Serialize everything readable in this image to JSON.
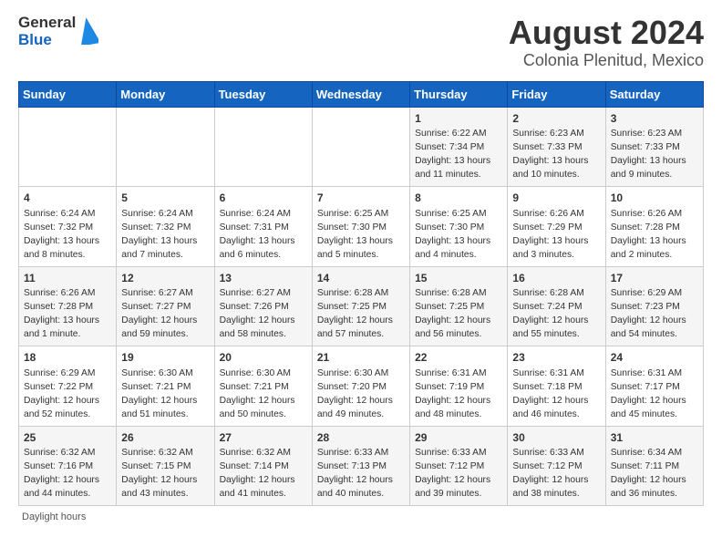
{
  "header": {
    "logo_line1": "General",
    "logo_line2": "Blue",
    "title": "August 2024",
    "subtitle": "Colonia Plenitud, Mexico"
  },
  "days_of_week": [
    "Sunday",
    "Monday",
    "Tuesday",
    "Wednesday",
    "Thursday",
    "Friday",
    "Saturday"
  ],
  "weeks": [
    [
      {
        "day": "",
        "info": ""
      },
      {
        "day": "",
        "info": ""
      },
      {
        "day": "",
        "info": ""
      },
      {
        "day": "",
        "info": ""
      },
      {
        "day": "1",
        "info": "Sunrise: 6:22 AM\nSunset: 7:34 PM\nDaylight: 13 hours and 11 minutes."
      },
      {
        "day": "2",
        "info": "Sunrise: 6:23 AM\nSunset: 7:33 PM\nDaylight: 13 hours and 10 minutes."
      },
      {
        "day": "3",
        "info": "Sunrise: 6:23 AM\nSunset: 7:33 PM\nDaylight: 13 hours and 9 minutes."
      }
    ],
    [
      {
        "day": "4",
        "info": "Sunrise: 6:24 AM\nSunset: 7:32 PM\nDaylight: 13 hours and 8 minutes."
      },
      {
        "day": "5",
        "info": "Sunrise: 6:24 AM\nSunset: 7:32 PM\nDaylight: 13 hours and 7 minutes."
      },
      {
        "day": "6",
        "info": "Sunrise: 6:24 AM\nSunset: 7:31 PM\nDaylight: 13 hours and 6 minutes."
      },
      {
        "day": "7",
        "info": "Sunrise: 6:25 AM\nSunset: 7:30 PM\nDaylight: 13 hours and 5 minutes."
      },
      {
        "day": "8",
        "info": "Sunrise: 6:25 AM\nSunset: 7:30 PM\nDaylight: 13 hours and 4 minutes."
      },
      {
        "day": "9",
        "info": "Sunrise: 6:26 AM\nSunset: 7:29 PM\nDaylight: 13 hours and 3 minutes."
      },
      {
        "day": "10",
        "info": "Sunrise: 6:26 AM\nSunset: 7:28 PM\nDaylight: 13 hours and 2 minutes."
      }
    ],
    [
      {
        "day": "11",
        "info": "Sunrise: 6:26 AM\nSunset: 7:28 PM\nDaylight: 13 hours and 1 minute."
      },
      {
        "day": "12",
        "info": "Sunrise: 6:27 AM\nSunset: 7:27 PM\nDaylight: 12 hours and 59 minutes."
      },
      {
        "day": "13",
        "info": "Sunrise: 6:27 AM\nSunset: 7:26 PM\nDaylight: 12 hours and 58 minutes."
      },
      {
        "day": "14",
        "info": "Sunrise: 6:28 AM\nSunset: 7:25 PM\nDaylight: 12 hours and 57 minutes."
      },
      {
        "day": "15",
        "info": "Sunrise: 6:28 AM\nSunset: 7:25 PM\nDaylight: 12 hours and 56 minutes."
      },
      {
        "day": "16",
        "info": "Sunrise: 6:28 AM\nSunset: 7:24 PM\nDaylight: 12 hours and 55 minutes."
      },
      {
        "day": "17",
        "info": "Sunrise: 6:29 AM\nSunset: 7:23 PM\nDaylight: 12 hours and 54 minutes."
      }
    ],
    [
      {
        "day": "18",
        "info": "Sunrise: 6:29 AM\nSunset: 7:22 PM\nDaylight: 12 hours and 52 minutes."
      },
      {
        "day": "19",
        "info": "Sunrise: 6:30 AM\nSunset: 7:21 PM\nDaylight: 12 hours and 51 minutes."
      },
      {
        "day": "20",
        "info": "Sunrise: 6:30 AM\nSunset: 7:21 PM\nDaylight: 12 hours and 50 minutes."
      },
      {
        "day": "21",
        "info": "Sunrise: 6:30 AM\nSunset: 7:20 PM\nDaylight: 12 hours and 49 minutes."
      },
      {
        "day": "22",
        "info": "Sunrise: 6:31 AM\nSunset: 7:19 PM\nDaylight: 12 hours and 48 minutes."
      },
      {
        "day": "23",
        "info": "Sunrise: 6:31 AM\nSunset: 7:18 PM\nDaylight: 12 hours and 46 minutes."
      },
      {
        "day": "24",
        "info": "Sunrise: 6:31 AM\nSunset: 7:17 PM\nDaylight: 12 hours and 45 minutes."
      }
    ],
    [
      {
        "day": "25",
        "info": "Sunrise: 6:32 AM\nSunset: 7:16 PM\nDaylight: 12 hours and 44 minutes."
      },
      {
        "day": "26",
        "info": "Sunrise: 6:32 AM\nSunset: 7:15 PM\nDaylight: 12 hours and 43 minutes."
      },
      {
        "day": "27",
        "info": "Sunrise: 6:32 AM\nSunset: 7:14 PM\nDaylight: 12 hours and 41 minutes."
      },
      {
        "day": "28",
        "info": "Sunrise: 6:33 AM\nSunset: 7:13 PM\nDaylight: 12 hours and 40 minutes."
      },
      {
        "day": "29",
        "info": "Sunrise: 6:33 AM\nSunset: 7:12 PM\nDaylight: 12 hours and 39 minutes."
      },
      {
        "day": "30",
        "info": "Sunrise: 6:33 AM\nSunset: 7:12 PM\nDaylight: 12 hours and 38 minutes."
      },
      {
        "day": "31",
        "info": "Sunrise: 6:34 AM\nSunset: 7:11 PM\nDaylight: 12 hours and 36 minutes."
      }
    ]
  ],
  "footer": "Daylight hours"
}
